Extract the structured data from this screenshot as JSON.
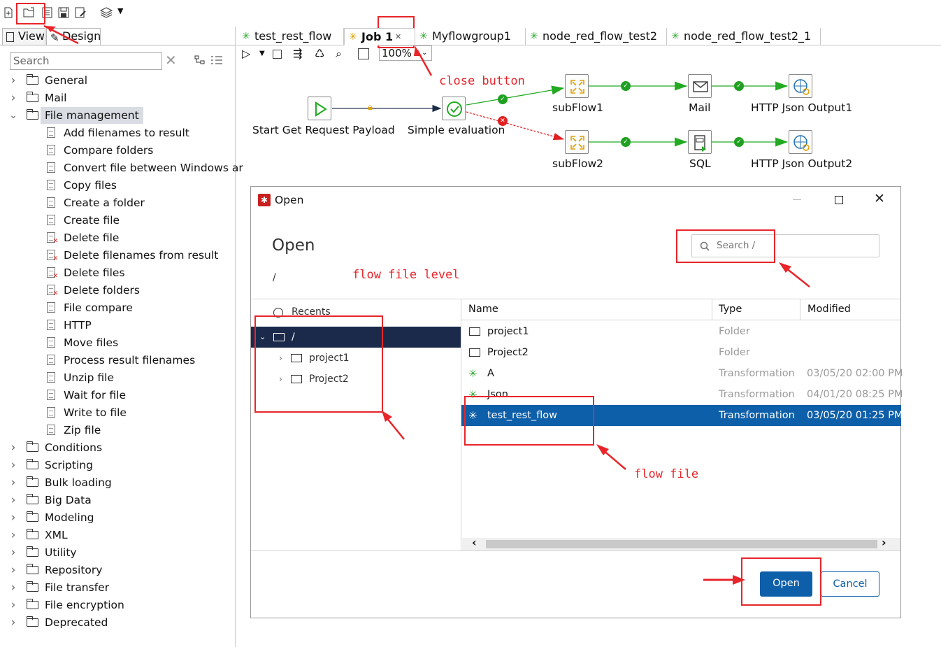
{
  "left_panel": {
    "tabs": {
      "view": "View",
      "design": "Design"
    },
    "search": {
      "placeholder": "Search",
      "value": "Search"
    },
    "tree": [
      {
        "label": "General",
        "type": "folder",
        "expanded": false
      },
      {
        "label": "Mail",
        "type": "folder",
        "expanded": false
      },
      {
        "label": "File management",
        "type": "folder",
        "expanded": true,
        "selected": true
      },
      {
        "label": "Add filenames to result",
        "type": "item"
      },
      {
        "label": "Compare folders",
        "type": "item"
      },
      {
        "label": "Convert file between Windows ar",
        "type": "item"
      },
      {
        "label": "Copy files",
        "type": "item"
      },
      {
        "label": "Create a folder",
        "type": "item"
      },
      {
        "label": "Create file",
        "type": "item"
      },
      {
        "label": "Delete file",
        "type": "item"
      },
      {
        "label": "Delete filenames from result",
        "type": "item"
      },
      {
        "label": "Delete files",
        "type": "item"
      },
      {
        "label": "Delete folders",
        "type": "item"
      },
      {
        "label": "File compare",
        "type": "item"
      },
      {
        "label": "HTTP",
        "type": "item"
      },
      {
        "label": "Move files",
        "type": "item"
      },
      {
        "label": "Process result filenames",
        "type": "item"
      },
      {
        "label": "Unzip file",
        "type": "item"
      },
      {
        "label": "Wait for file",
        "type": "item"
      },
      {
        "label": "Write to file",
        "type": "item"
      },
      {
        "label": "Zip file",
        "type": "item"
      },
      {
        "label": "Conditions",
        "type": "folder",
        "expanded": false
      },
      {
        "label": "Scripting",
        "type": "folder",
        "expanded": false
      },
      {
        "label": "Bulk loading",
        "type": "folder",
        "expanded": false
      },
      {
        "label": "Big Data",
        "type": "folder",
        "expanded": false
      },
      {
        "label": "Modeling",
        "type": "folder",
        "expanded": false
      },
      {
        "label": "XML",
        "type": "folder",
        "expanded": false
      },
      {
        "label": "Utility",
        "type": "folder",
        "expanded": false
      },
      {
        "label": "Repository",
        "type": "folder",
        "expanded": false
      },
      {
        "label": "File transfer",
        "type": "folder",
        "expanded": false
      },
      {
        "label": "File encryption",
        "type": "folder",
        "expanded": false
      },
      {
        "label": "Deprecated",
        "type": "folder",
        "expanded": false
      }
    ]
  },
  "editor": {
    "tabs": [
      {
        "label": "test_rest_flow"
      },
      {
        "label": "Job 1",
        "active": true
      },
      {
        "label": "Myflowgroup1"
      },
      {
        "label": "node_red_flow_test2"
      },
      {
        "label": "node_red_flow_test2_1"
      }
    ],
    "zoom": "100%",
    "nodes": {
      "start": "Start Get Request Payload",
      "eval": "Simple evaluation",
      "subflow1": "subFlow1",
      "mail": "Mail",
      "http1": "HTTP Json Output1",
      "subflow2": "subFlow2",
      "sql": "SQL",
      "http2": "HTTP Json Output2"
    }
  },
  "annotations": {
    "close_button": "close button",
    "flow_file_level": "flow file level",
    "flow_file": "flow file"
  },
  "dialog": {
    "title": "Open",
    "heading": "Open",
    "path": "/",
    "search_placeholder": "Search /",
    "recents": "Recents",
    "tree": {
      "root": "/",
      "children": [
        "project1",
        "Project2"
      ]
    },
    "columns": {
      "name": "Name",
      "type": "Type",
      "modified": "Modified"
    },
    "files": [
      {
        "name": "project1",
        "type": "Folder",
        "modified": "",
        "kind": "folder"
      },
      {
        "name": "Project2",
        "type": "Folder",
        "modified": "",
        "kind": "folder"
      },
      {
        "name": "A",
        "type": "Transformation",
        "modified": "03/05/20 02:00 PM",
        "kind": "trans"
      },
      {
        "name": "Json",
        "type": "Transformation",
        "modified": "04/01/20 08:25 PM",
        "kind": "trans"
      },
      {
        "name": "test_rest_flow",
        "type": "Transformation",
        "modified": "03/05/20 01:25 PM",
        "kind": "trans",
        "selected": true
      }
    ],
    "buttons": {
      "open": "Open",
      "cancel": "Cancel"
    }
  },
  "colors": {
    "accent": "#0e5fa9",
    "annotation": "#e8252a",
    "ok": "#20a020",
    "error": "#e02020",
    "tree_selected": "#1b2a4a"
  }
}
